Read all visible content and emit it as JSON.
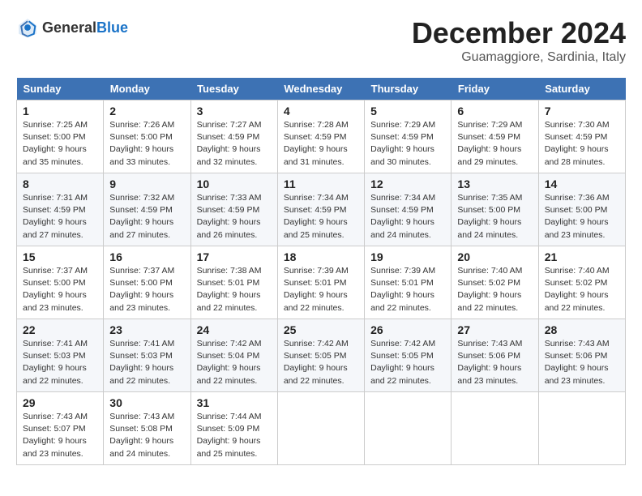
{
  "header": {
    "logo_general": "General",
    "logo_blue": "Blue",
    "month": "December 2024",
    "location": "Guamaggiore, Sardinia, Italy"
  },
  "weekdays": [
    "Sunday",
    "Monday",
    "Tuesday",
    "Wednesday",
    "Thursday",
    "Friday",
    "Saturday"
  ],
  "weeks": [
    [
      {
        "day": "1",
        "sunrise": "Sunrise: 7:25 AM",
        "sunset": "Sunset: 5:00 PM",
        "daylight": "Daylight: 9 hours and 35 minutes."
      },
      {
        "day": "2",
        "sunrise": "Sunrise: 7:26 AM",
        "sunset": "Sunset: 5:00 PM",
        "daylight": "Daylight: 9 hours and 33 minutes."
      },
      {
        "day": "3",
        "sunrise": "Sunrise: 7:27 AM",
        "sunset": "Sunset: 4:59 PM",
        "daylight": "Daylight: 9 hours and 32 minutes."
      },
      {
        "day": "4",
        "sunrise": "Sunrise: 7:28 AM",
        "sunset": "Sunset: 4:59 PM",
        "daylight": "Daylight: 9 hours and 31 minutes."
      },
      {
        "day": "5",
        "sunrise": "Sunrise: 7:29 AM",
        "sunset": "Sunset: 4:59 PM",
        "daylight": "Daylight: 9 hours and 30 minutes."
      },
      {
        "day": "6",
        "sunrise": "Sunrise: 7:29 AM",
        "sunset": "Sunset: 4:59 PM",
        "daylight": "Daylight: 9 hours and 29 minutes."
      },
      {
        "day": "7",
        "sunrise": "Sunrise: 7:30 AM",
        "sunset": "Sunset: 4:59 PM",
        "daylight": "Daylight: 9 hours and 28 minutes."
      }
    ],
    [
      {
        "day": "8",
        "sunrise": "Sunrise: 7:31 AM",
        "sunset": "Sunset: 4:59 PM",
        "daylight": "Daylight: 9 hours and 27 minutes."
      },
      {
        "day": "9",
        "sunrise": "Sunrise: 7:32 AM",
        "sunset": "Sunset: 4:59 PM",
        "daylight": "Daylight: 9 hours and 27 minutes."
      },
      {
        "day": "10",
        "sunrise": "Sunrise: 7:33 AM",
        "sunset": "Sunset: 4:59 PM",
        "daylight": "Daylight: 9 hours and 26 minutes."
      },
      {
        "day": "11",
        "sunrise": "Sunrise: 7:34 AM",
        "sunset": "Sunset: 4:59 PM",
        "daylight": "Daylight: 9 hours and 25 minutes."
      },
      {
        "day": "12",
        "sunrise": "Sunrise: 7:34 AM",
        "sunset": "Sunset: 4:59 PM",
        "daylight": "Daylight: 9 hours and 24 minutes."
      },
      {
        "day": "13",
        "sunrise": "Sunrise: 7:35 AM",
        "sunset": "Sunset: 5:00 PM",
        "daylight": "Daylight: 9 hours and 24 minutes."
      },
      {
        "day": "14",
        "sunrise": "Sunrise: 7:36 AM",
        "sunset": "Sunset: 5:00 PM",
        "daylight": "Daylight: 9 hours and 23 minutes."
      }
    ],
    [
      {
        "day": "15",
        "sunrise": "Sunrise: 7:37 AM",
        "sunset": "Sunset: 5:00 PM",
        "daylight": "Daylight: 9 hours and 23 minutes."
      },
      {
        "day": "16",
        "sunrise": "Sunrise: 7:37 AM",
        "sunset": "Sunset: 5:00 PM",
        "daylight": "Daylight: 9 hours and 23 minutes."
      },
      {
        "day": "17",
        "sunrise": "Sunrise: 7:38 AM",
        "sunset": "Sunset: 5:01 PM",
        "daylight": "Daylight: 9 hours and 22 minutes."
      },
      {
        "day": "18",
        "sunrise": "Sunrise: 7:39 AM",
        "sunset": "Sunset: 5:01 PM",
        "daylight": "Daylight: 9 hours and 22 minutes."
      },
      {
        "day": "19",
        "sunrise": "Sunrise: 7:39 AM",
        "sunset": "Sunset: 5:01 PM",
        "daylight": "Daylight: 9 hours and 22 minutes."
      },
      {
        "day": "20",
        "sunrise": "Sunrise: 7:40 AM",
        "sunset": "Sunset: 5:02 PM",
        "daylight": "Daylight: 9 hours and 22 minutes."
      },
      {
        "day": "21",
        "sunrise": "Sunrise: 7:40 AM",
        "sunset": "Sunset: 5:02 PM",
        "daylight": "Daylight: 9 hours and 22 minutes."
      }
    ],
    [
      {
        "day": "22",
        "sunrise": "Sunrise: 7:41 AM",
        "sunset": "Sunset: 5:03 PM",
        "daylight": "Daylight: 9 hours and 22 minutes."
      },
      {
        "day": "23",
        "sunrise": "Sunrise: 7:41 AM",
        "sunset": "Sunset: 5:03 PM",
        "daylight": "Daylight: 9 hours and 22 minutes."
      },
      {
        "day": "24",
        "sunrise": "Sunrise: 7:42 AM",
        "sunset": "Sunset: 5:04 PM",
        "daylight": "Daylight: 9 hours and 22 minutes."
      },
      {
        "day": "25",
        "sunrise": "Sunrise: 7:42 AM",
        "sunset": "Sunset: 5:05 PM",
        "daylight": "Daylight: 9 hours and 22 minutes."
      },
      {
        "day": "26",
        "sunrise": "Sunrise: 7:42 AM",
        "sunset": "Sunset: 5:05 PM",
        "daylight": "Daylight: 9 hours and 22 minutes."
      },
      {
        "day": "27",
        "sunrise": "Sunrise: 7:43 AM",
        "sunset": "Sunset: 5:06 PM",
        "daylight": "Daylight: 9 hours and 23 minutes."
      },
      {
        "day": "28",
        "sunrise": "Sunrise: 7:43 AM",
        "sunset": "Sunset: 5:06 PM",
        "daylight": "Daylight: 9 hours and 23 minutes."
      }
    ],
    [
      {
        "day": "29",
        "sunrise": "Sunrise: 7:43 AM",
        "sunset": "Sunset: 5:07 PM",
        "daylight": "Daylight: 9 hours and 23 minutes."
      },
      {
        "day": "30",
        "sunrise": "Sunrise: 7:43 AM",
        "sunset": "Sunset: 5:08 PM",
        "daylight": "Daylight: 9 hours and 24 minutes."
      },
      {
        "day": "31",
        "sunrise": "Sunrise: 7:44 AM",
        "sunset": "Sunset: 5:09 PM",
        "daylight": "Daylight: 9 hours and 25 minutes."
      },
      null,
      null,
      null,
      null
    ]
  ]
}
